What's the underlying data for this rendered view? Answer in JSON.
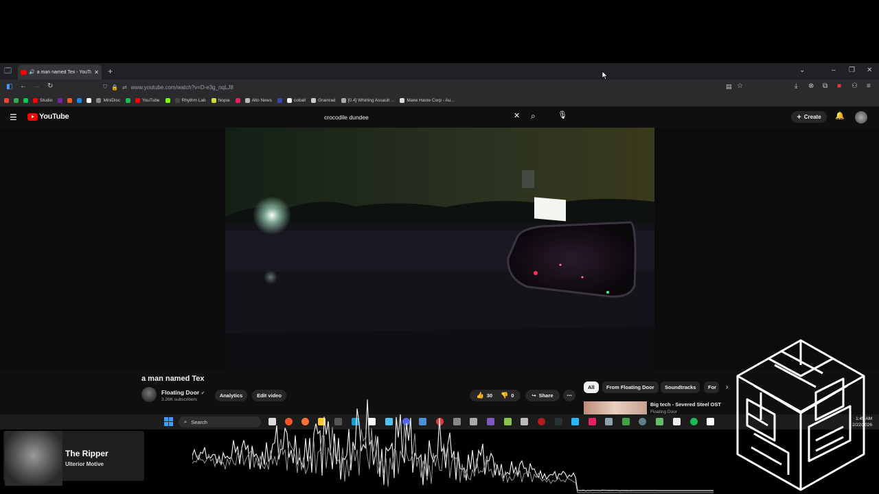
{
  "browser": {
    "tab_title": "a man named Tex - YouTube",
    "new_tab": "+",
    "url": "www.youtube.com/watch?v=D-e3g_nqLJ8",
    "bookmarks": [
      {
        "label": "",
        "color": "#ea4335"
      },
      {
        "label": "",
        "color": "#34a853"
      },
      {
        "label": "",
        "color": "#00c853"
      },
      {
        "label": "Studio",
        "color": "#ff0000"
      },
      {
        "label": "",
        "color": "#7b1fa2"
      },
      {
        "label": "",
        "color": "#ff5722"
      },
      {
        "label": "",
        "color": "#1e88e5"
      },
      {
        "label": "",
        "color": "#ffffff"
      },
      {
        "label": "MiniDisc",
        "color": "#888888"
      },
      {
        "label": "",
        "color": "#1db954"
      },
      {
        "label": "YouTube",
        "color": "#ff0000"
      },
      {
        "label": "",
        "color": "#76ff03"
      },
      {
        "label": "Rhythm Lab",
        "color": "#444444"
      },
      {
        "label": "Nopia",
        "color": "#cddc39"
      },
      {
        "label": "",
        "color": "#e91e63"
      },
      {
        "label": "Alto News",
        "color": "#bbbbbb"
      },
      {
        "label": "",
        "color": "#3949ab"
      },
      {
        "label": "cobalt",
        "color": "#eeeeee"
      },
      {
        "label": "Grainrad",
        "color": "#cccccc"
      },
      {
        "label": "[0.4] Whirling Assault ...",
        "color": "#aaaaaa"
      },
      {
        "label": "Make Haste Corp - Au...",
        "color": "#dddddd"
      }
    ]
  },
  "youtube": {
    "logo_text": "YouTube",
    "search_query": "crocodile dundee",
    "create_label": "Create",
    "video_title": "a man named Tex",
    "channel_name": "Floating Door",
    "subscribers": "3.26K subscribers",
    "analytics_label": "Analytics",
    "edit_video_label": "Edit video",
    "likes": "30",
    "dislikes": "0",
    "share_label": "Share",
    "chips": [
      "All",
      "From Floating Door",
      "Soundtracks",
      "For"
    ],
    "recommendation": {
      "title": "Big tech - Severed Steel OST",
      "channel": "Floating Door"
    }
  },
  "taskbar": {
    "search_label": "Search",
    "time": "1:45 AM",
    "date": "2/22/2026"
  },
  "now_playing": {
    "title": "The Ripper",
    "artist": "Ulterior Motive"
  }
}
